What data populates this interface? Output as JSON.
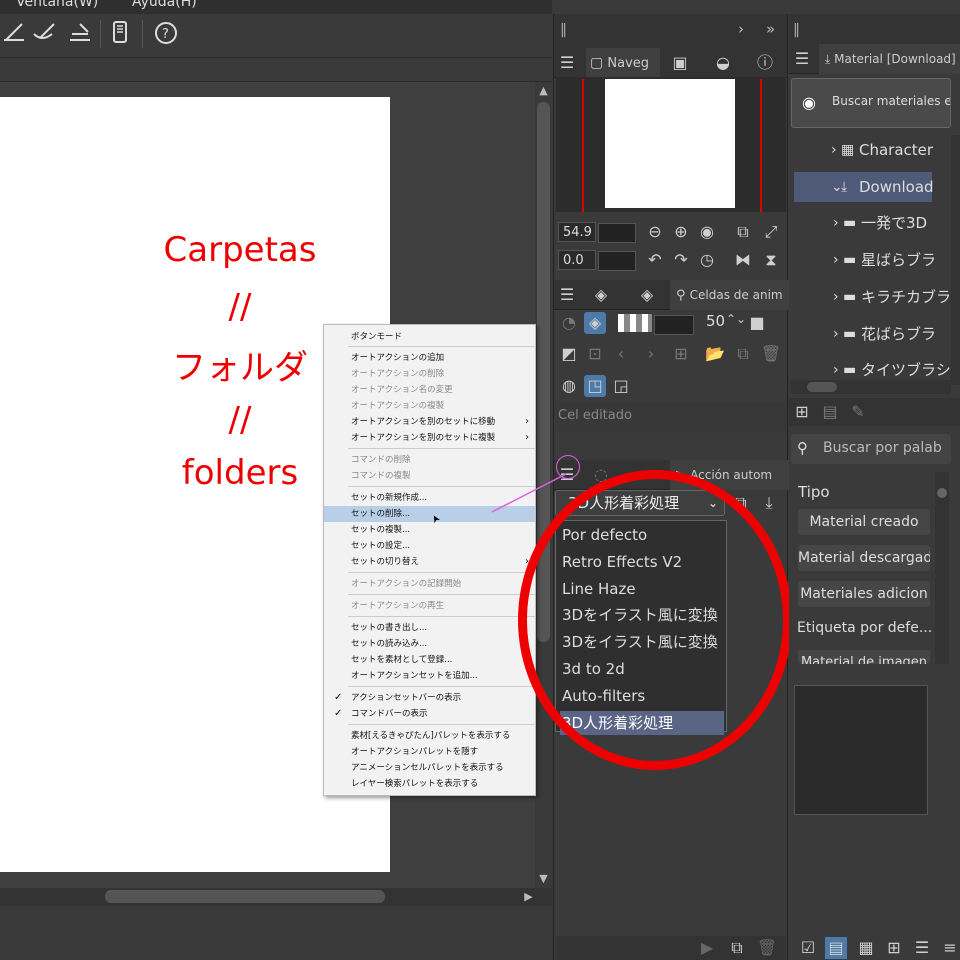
{
  "menubar": {
    "ventana": "Ventana(W)",
    "ayuda": "Ayuda(H)"
  },
  "annotation": {
    "line1": "Carpetas",
    "line2": "//",
    "line3": "フォルダ",
    "line4": "//",
    "line5": "folders",
    "color": "#e00000"
  },
  "context_menu": {
    "items": [
      {
        "label": "ボタンモード",
        "disabled": false
      },
      {
        "label": "オートアクションの追加",
        "disabled": false
      },
      {
        "label": "オートアクションの削除",
        "disabled": true
      },
      {
        "label": "オートアクション名の変更",
        "disabled": true
      },
      {
        "label": "オートアクションの複製",
        "disabled": true
      },
      {
        "label": "オートアクションを別のセットに移動",
        "disabled": false,
        "submenu": true
      },
      {
        "label": "オートアクションを別のセットに複製",
        "disabled": false,
        "submenu": true
      },
      {
        "label": "コマンドの削除",
        "disabled": true
      },
      {
        "label": "コマンドの複製",
        "disabled": true
      },
      {
        "label": "セットの新規作成...",
        "disabled": false
      },
      {
        "label": "セットの削除...",
        "disabled": false,
        "selected": true
      },
      {
        "label": "セットの複製...",
        "disabled": false
      },
      {
        "label": "セットの設定...",
        "disabled": false
      },
      {
        "label": "セットの切り替え",
        "disabled": false,
        "submenu": true
      },
      {
        "label": "オートアクションの記録開始",
        "disabled": true
      },
      {
        "label": "オートアクションの再生",
        "disabled": true
      },
      {
        "label": "セットの書き出し...",
        "disabled": false
      },
      {
        "label": "セットの読み込み...",
        "disabled": false
      },
      {
        "label": "セットを素材として登録...",
        "disabled": false
      },
      {
        "label": "オートアクションセットを追加...",
        "disabled": false
      },
      {
        "label": "アクションセットバーの表示",
        "disabled": false,
        "checked": true
      },
      {
        "label": "コマンドバーの表示",
        "disabled": false,
        "checked": true
      },
      {
        "label": "素材[えるきゃぴたん]パレットを表示する",
        "disabled": false
      },
      {
        "label": "オートアクションパレットを隠す",
        "disabled": false
      },
      {
        "label": "アニメーションセルパレットを表示する",
        "disabled": false
      },
      {
        "label": "レイヤー検索パレットを表示する",
        "disabled": false
      }
    ]
  },
  "navigator": {
    "tab_label": "Naveg",
    "zoom": "54.9",
    "angle": "0.0"
  },
  "cels": {
    "tab_label": "Celdas de anim",
    "opacity": "50",
    "status": "Cel editado"
  },
  "auto_action": {
    "tab_label": "Acción autom",
    "current_set": "3D人形着彩処理",
    "sets": [
      "Por defecto",
      "Retro Effects V2",
      "Line Haze",
      "3Dをイラスト風に変換",
      "3Dをイラスト風に変換",
      "3d to 2d",
      "Auto-filters",
      "3D人形着彩処理"
    ]
  },
  "material": {
    "tab_label": "Material [Download]",
    "search_button": "Buscar materiales en A",
    "tree": [
      {
        "label": "Character",
        "level": 1,
        "expanded": false
      },
      {
        "label": "Download",
        "level": 1,
        "expanded": true,
        "selected": true
      },
      {
        "label": "一発で3D",
        "level": 2
      },
      {
        "label": "星ばらブラ",
        "level": 2
      },
      {
        "label": "キラチカブラ",
        "level": 2
      },
      {
        "label": "花ばらブラ",
        "level": 2
      },
      {
        "label": "タイツブラシ",
        "level": 2
      }
    ],
    "search_placeholder": "Buscar por palab",
    "type_label": "Tipo",
    "type_buttons": [
      "Material creado",
      "Material descargad",
      "Materiales adicion"
    ],
    "tag_label": "Etiqueta por defe...",
    "tag_partial": "Material de imagen"
  }
}
